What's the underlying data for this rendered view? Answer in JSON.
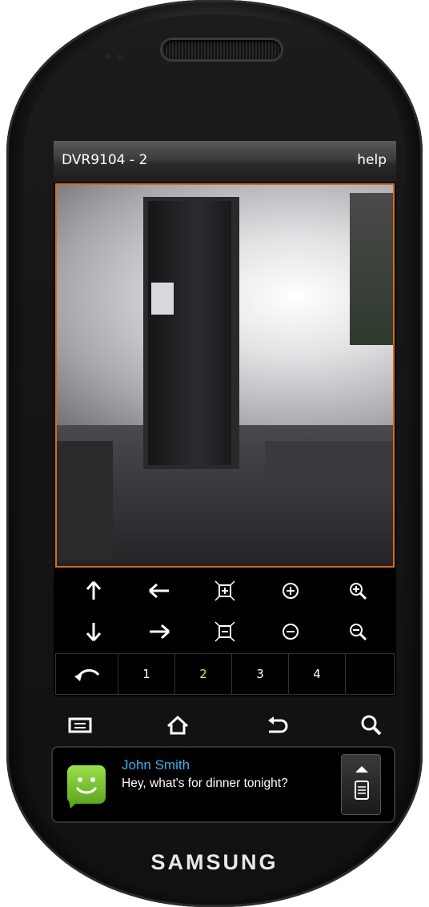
{
  "device": {
    "brand": "SAMSUNG"
  },
  "app": {
    "title": "DVR9104 - 2",
    "help_label": "help"
  },
  "controls": {
    "row1": [
      "arrow-up-icon",
      "arrow-left-icon",
      "zoom-fit-in-icon",
      "focus-plus-icon",
      "zoom-in-icon"
    ],
    "row2": [
      "arrow-down-icon",
      "arrow-right-icon",
      "zoom-fit-out-icon",
      "focus-minus-icon",
      "zoom-out-icon"
    ]
  },
  "tabs": [
    {
      "label": "1"
    },
    {
      "label": "2",
      "active": true
    },
    {
      "label": "3"
    },
    {
      "label": "4"
    },
    {
      "label": ""
    }
  ],
  "accent_colors": {
    "border": "#d86a1b",
    "active_tab": "#f4e23a",
    "contact": "#3ab1e8"
  },
  "notification": {
    "name": "John Smith",
    "message": "Hey, what's for dinner tonight?"
  }
}
